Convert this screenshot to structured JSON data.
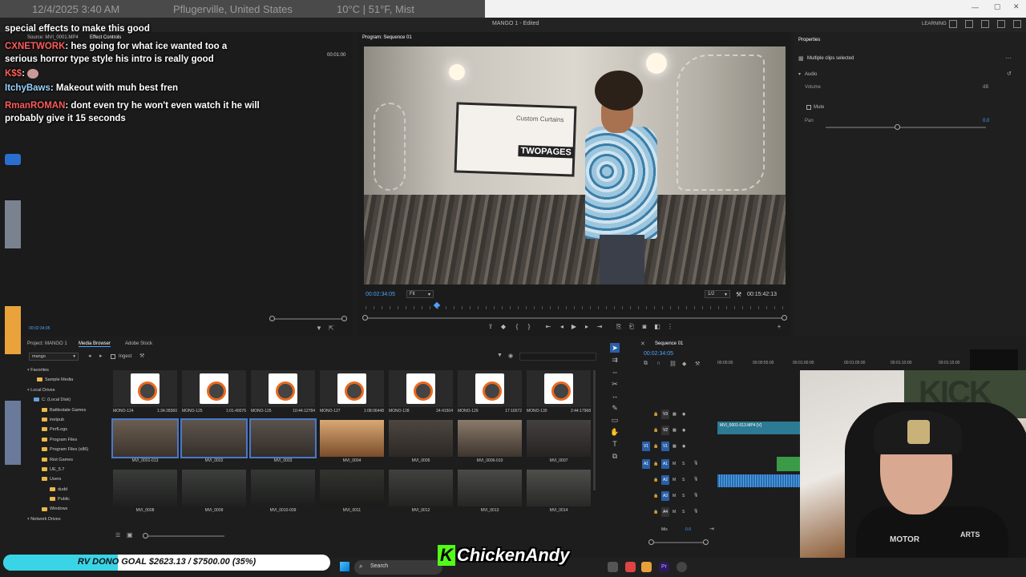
{
  "top_bar": {
    "datetime": "12/4/2025 3:40 AM",
    "location": "Pflugerville, United States",
    "weather": "10°C | 51°F, Mist"
  },
  "app": {
    "title": "MANGO 1 - Edited",
    "learning_label": "LEARNING"
  },
  "chat": [
    {
      "user": "",
      "message": "special effects to make this good"
    },
    {
      "user": "CXNETWORK",
      "message": "hes going for what ice wanted too a serious horror type style his intro is really good"
    },
    {
      "user": "K$$",
      "message": ""
    },
    {
      "user": "ItchyBaws",
      "message": "Makeout with muh best fren"
    },
    {
      "user": "RmanROMAN",
      "message": "dont even try he won't even watch it he will probably give it 15 seconds"
    }
  ],
  "source_panel": {
    "tabs": [
      "Source: MVI_0001.MP4",
      "Effect Controls"
    ],
    "timecode": "00:01:00",
    "bottom_timecode": "00:02:34:05"
  },
  "program_panel": {
    "title": "Program: Sequence 01",
    "current_time": "00:02:34:05",
    "fit_label": "Fit",
    "resolution_label": "1/2",
    "duration": "00:15:42:13",
    "playhead_fraction": 0.17,
    "video_sign_title": "Custom Curtains",
    "video_sign_brand": "TWOPAGES"
  },
  "properties_panel": {
    "title": "Properties",
    "selection": "Multiple clips selected",
    "section": "Audio",
    "volume_label": "Volume",
    "volume_unit": "dB",
    "mute_label": "Mute",
    "pan_label": "Pan",
    "pan_value": "0.0"
  },
  "project_panel": {
    "tabs": [
      "Project: MANGO 1",
      "Media Browser",
      "Adobe Stock"
    ],
    "drive_select": "mango",
    "ingest_label": "Ingest",
    "tree": [
      {
        "label": "Favorites",
        "folder": false
      },
      {
        "label": "Sample Media",
        "folder": true
      },
      {
        "label": "Local Drives",
        "folder": false
      },
      {
        "label": "C: (Local Disk)",
        "folder": true
      },
      {
        "label": "Battlestate Games",
        "folder": true
      },
      {
        "label": "inetpub",
        "folder": true
      },
      {
        "label": "PerfLogs",
        "folder": true
      },
      {
        "label": "Program Files",
        "folder": true
      },
      {
        "label": "Program Files (x86)",
        "folder": true
      },
      {
        "label": "Riot Games",
        "folder": true
      },
      {
        "label": "UE_5.7",
        "folder": true
      },
      {
        "label": "Users",
        "folder": true
      },
      {
        "label": "dudd",
        "folder": true
      },
      {
        "label": "Public",
        "folder": true
      },
      {
        "label": "Windows",
        "folder": true
      },
      {
        "label": "Network Drives",
        "folder": false
      }
    ],
    "thumbs_row1": [
      {
        "name": "MONO-124",
        "duration": "1:34:28360"
      },
      {
        "name": "MONO-125",
        "duration": "1:01:40076"
      },
      {
        "name": "MONO-126",
        "duration": "10:44:12784"
      },
      {
        "name": "MONO-127",
        "duration": "1:08:06448"
      },
      {
        "name": "MONO-128",
        "duration": "24:41504"
      },
      {
        "name": "MONO-129",
        "duration": "17:16572"
      },
      {
        "name": "MONO-130",
        "duration": "2:44:17968"
      }
    ],
    "thumbs_row2": [
      "MVI_0001-013",
      "MVI_0002",
      "MVI_0003",
      "MVI_0004",
      "MVI_0005",
      "MVI_0006-010",
      "MVI_0007"
    ],
    "thumbs_row3": [
      "MVI_0008",
      "MVI_0009",
      "MVI_0010-009",
      "MVI_0011",
      "MVI_0012",
      "MVI_0013",
      "MVI_0014"
    ]
  },
  "sequence_panel": {
    "title": "Sequence 01",
    "current_time": "00:02:34:05",
    "ruler": [
      "00:00:00",
      "00:00:55:00",
      "00:01:00:00",
      "00:01:05:00",
      "00:01:10:00",
      "00:01:15:00"
    ],
    "video_tracks": [
      "V3",
      "V2",
      "V1"
    ],
    "audio_tracks": [
      "A1",
      "A2",
      "A3",
      "A4"
    ],
    "clip_label": "MVI_0001-013.MP4 [V]",
    "mix_label": "Mix",
    "mix_value": "0.0"
  },
  "overlay": {
    "goal_text": "RV DONO GOAL $2623.13 / $7500.00 (35%)",
    "goal_progress": 0.35,
    "logo_k": "K",
    "logo_text": "ChickenAndy",
    "cam_banner": "KICK",
    "cam_shirt_text1": "MOTOR",
    "cam_shirt_text2": "ARTS"
  },
  "taskbar": {
    "search_placeholder": "Search"
  },
  "colors": {
    "accent_blue": "#4aa3ff",
    "goal_fill": "#39d4e6",
    "kick_green": "#53fc18",
    "chat_username": "#ff5b5b"
  }
}
